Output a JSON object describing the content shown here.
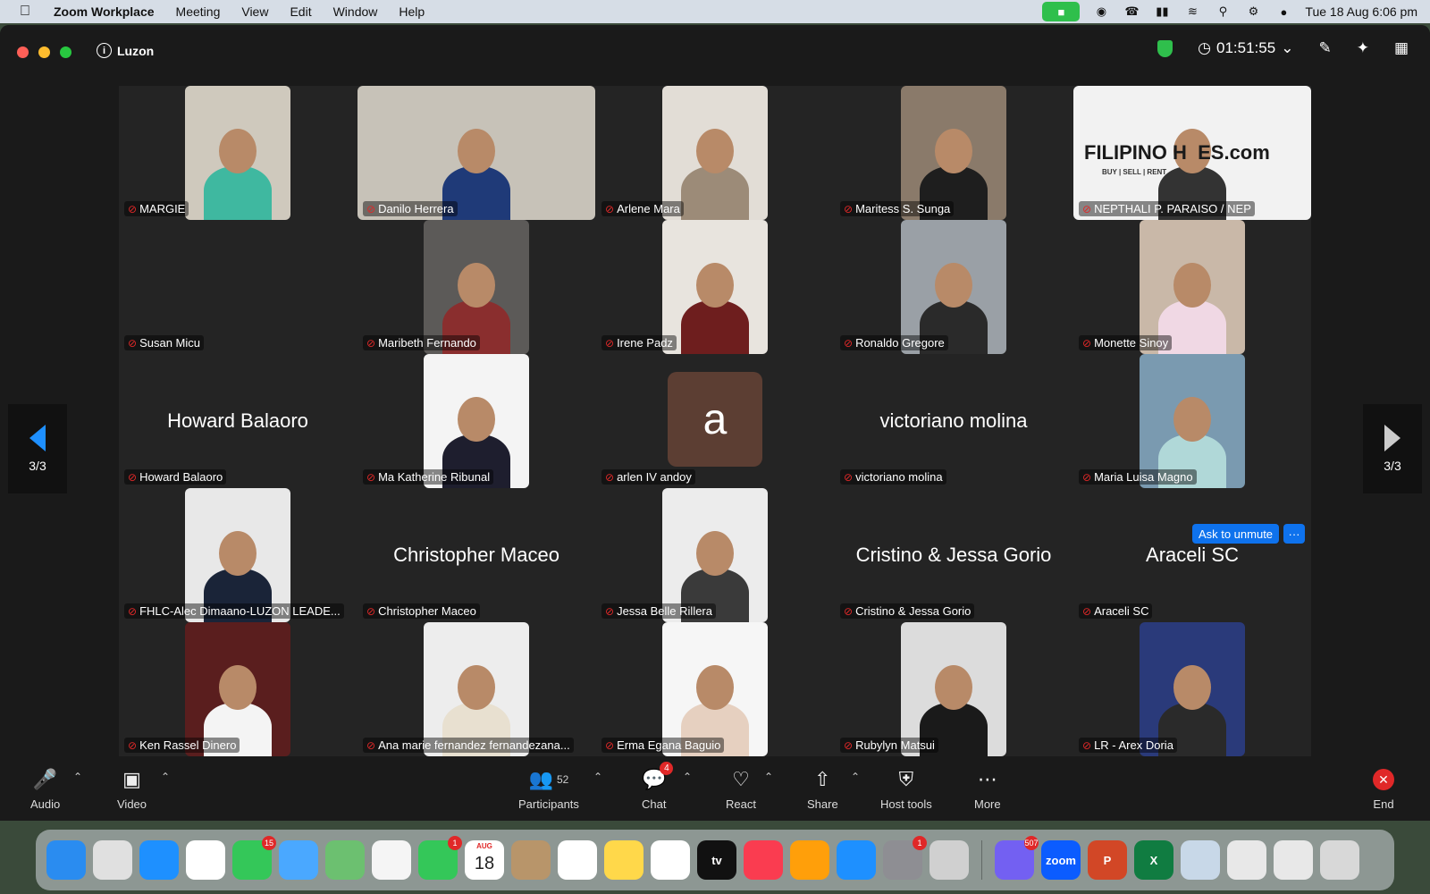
{
  "menubar": {
    "app_name": "Zoom Workplace",
    "menus": [
      "Meeting",
      "View",
      "Edit",
      "Window",
      "Help"
    ],
    "clock": "Tue 18 Aug  6:06 pm"
  },
  "window": {
    "meeting_name": "Luzon",
    "timer": "01:51:55"
  },
  "gallery": {
    "page_indicator": "3/3",
    "ask_to_unmute_label": "Ask to unmute",
    "more_label": "···",
    "participants": [
      {
        "name": "MARGIE",
        "video": true,
        "bg": "#cfc9bd",
        "shirt": "#3fb8a0"
      },
      {
        "name": "Danilo Herrera",
        "video": true,
        "bg": "#c7c2b8",
        "shirt": "#1f3a78"
      },
      {
        "name": "Arlene Mara",
        "video": true,
        "bg": "#e2ddd6",
        "shirt": "#9c8b78"
      },
      {
        "name": "Maritess S. Sunga",
        "video": true,
        "bg": "#8a7a6a",
        "shirt": "#1e1e1e"
      },
      {
        "name": "NEPTHALI P. PARAISO / NEP",
        "video": true,
        "bg": "#f2f2f2",
        "shirt": "#333333",
        "logo_text": "FILIPINO H  ES.com",
        "logo_tagline": "BUY | SELL | RENT"
      },
      {
        "name": "Susan Micu",
        "video": false
      },
      {
        "name": "Maribeth Fernando",
        "video": true,
        "bg": "#5c5a58",
        "shirt": "#8a2e2e"
      },
      {
        "name": "Irene Padz",
        "video": true,
        "bg": "#e8e4de",
        "shirt": "#6e1e1e"
      },
      {
        "name": "Ronaldo Gregore",
        "video": true,
        "bg": "#9aa0a6",
        "shirt": "#2a2a2a"
      },
      {
        "name": "Monette Sinoy",
        "video": true,
        "bg": "#c9b8a8",
        "shirt": "#f0d8e4"
      },
      {
        "name": "Howard Balaoro",
        "video": false,
        "big_name": "Howard Balaoro"
      },
      {
        "name": "Ma Katherine Ribunal",
        "video": true,
        "bg": "#f4f4f4",
        "shirt": "#1e1e2e"
      },
      {
        "name": "arlen IV andoy",
        "video": false,
        "avatar_letter": "a"
      },
      {
        "name": "victoriano molina",
        "video": false,
        "big_name": "victoriano molina"
      },
      {
        "name": "Maria Luisa Magno",
        "video": true,
        "bg": "#7a9ab0",
        "shirt": "#b0d8d8"
      },
      {
        "name": "FHLC-Alec Dimaano-LUZON LEADE...",
        "video": true,
        "bg": "#e8e8e8",
        "shirt": "#1a2438"
      },
      {
        "name": "Christopher Maceo",
        "video": false,
        "big_name": "Christopher Maceo"
      },
      {
        "name": "Jessa Belle Rillera",
        "video": true,
        "bg": "#ececec",
        "shirt": "#3a3a3a"
      },
      {
        "name": "Cristino & Jessa Gorio",
        "video": false,
        "big_name": "Cristino & Jessa Gorio"
      },
      {
        "name": "Araceli SC",
        "video": false,
        "big_name": "Araceli SC"
      },
      {
        "name": "Ken Rassel Dinero",
        "video": true,
        "bg": "#5a1e1e",
        "shirt": "#f4f4f4"
      },
      {
        "name": "Ana marie fernandez fernandezana...",
        "video": true,
        "bg": "#ededed",
        "shirt": "#e8e0d0"
      },
      {
        "name": "Erma Egana Baguio",
        "video": true,
        "bg": "#f6f6f6",
        "shirt": "#e6d0c0"
      },
      {
        "name": "Rubylyn Matsui",
        "video": true,
        "bg": "#dcdcdc",
        "shirt": "#1a1a1a"
      },
      {
        "name": "LR - Arex Doria",
        "video": true,
        "bg": "#2a3a7a",
        "shirt": "#2a2a2a"
      }
    ]
  },
  "toolbar": {
    "audio": "Audio",
    "video": "Video",
    "participants": "Participants",
    "participants_count": "52",
    "chat": "Chat",
    "chat_badge": "4",
    "react": "React",
    "share": "Share",
    "host_tools": "Host tools",
    "more": "More",
    "end": "End"
  },
  "dock": {
    "apps": [
      {
        "name": "finder",
        "color": "#2a8cf0"
      },
      {
        "name": "launchpad",
        "color": "#e0e0e0"
      },
      {
        "name": "safari",
        "color": "#1e90ff"
      },
      {
        "name": "opera",
        "color": "#ffffff"
      },
      {
        "name": "messages",
        "color": "#34c759",
        "badge": "15"
      },
      {
        "name": "mail",
        "color": "#4aa8ff"
      },
      {
        "name": "maps",
        "color": "#6cc070"
      },
      {
        "name": "photos",
        "color": "#f5f5f5"
      },
      {
        "name": "facetime",
        "color": "#34c759",
        "badge": "1"
      },
      {
        "name": "calendar",
        "color": "#ffffff",
        "month": "AUG",
        "day": "18"
      },
      {
        "name": "contacts",
        "color": "#b8956a"
      },
      {
        "name": "reminders",
        "color": "#ffffff"
      },
      {
        "name": "notes",
        "color": "#ffd84a"
      },
      {
        "name": "freeform",
        "color": "#ffffff"
      },
      {
        "name": "tv",
        "color": "#111111",
        "text": "tv"
      },
      {
        "name": "music",
        "color": "#fa3c50"
      },
      {
        "name": "pages",
        "color": "#ff9f0a"
      },
      {
        "name": "app-store",
        "color": "#1e90ff"
      },
      {
        "name": "system-settings",
        "color": "#8e8e93",
        "badge": "1"
      },
      {
        "name": "iphone-mirroring",
        "color": "#d0d0d0"
      },
      {
        "name": "viber",
        "color": "#7360f2",
        "badge": "507"
      },
      {
        "name": "zoom",
        "color": "#0b5cff",
        "text": "zoom"
      },
      {
        "name": "powerpoint",
        "color": "#d24726",
        "text": "P"
      },
      {
        "name": "excel",
        "color": "#107c41",
        "text": "X"
      },
      {
        "name": "preview",
        "color": "#c8d8e8"
      },
      {
        "name": "doc-thumb-1",
        "color": "#e8e8e8"
      },
      {
        "name": "doc-thumb-2",
        "color": "#e8e8e8"
      },
      {
        "name": "trash",
        "color": "#d8d8d8"
      }
    ]
  }
}
